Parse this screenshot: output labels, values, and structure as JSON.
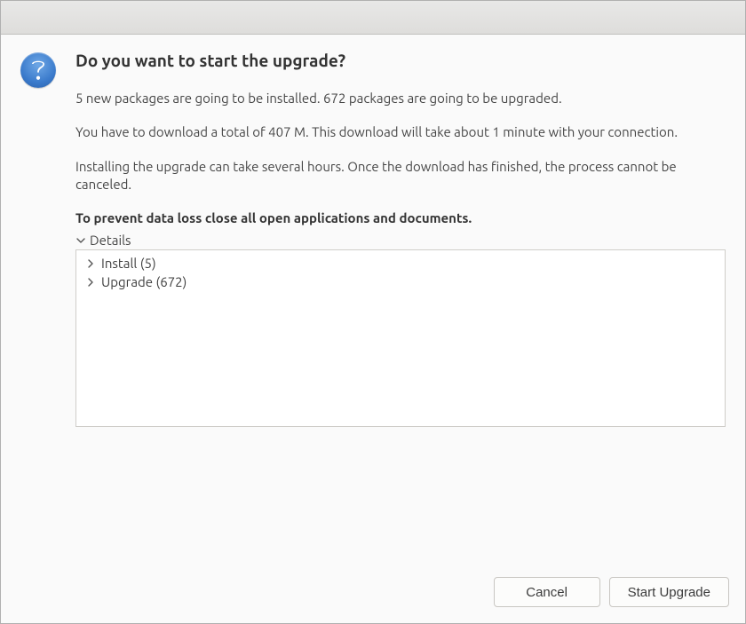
{
  "heading": "Do you want to start the upgrade?",
  "paragraphs": {
    "pkg_summary": "5 new packages are going to be installed. 672 packages are going to be upgraded.",
    "download_info": "You have to download a total of 407 M. This download will take about 1 minute with your connection.",
    "install_warning": "Installing the upgrade can take several hours. Once the download has finished, the process cannot be canceled.",
    "data_loss_warning": "To prevent data loss close all open applications and documents."
  },
  "details": {
    "label": "Details",
    "groups": [
      {
        "label": "Install (5)"
      },
      {
        "label": "Upgrade (672)"
      }
    ]
  },
  "buttons": {
    "cancel": "Cancel",
    "start": "Start Upgrade"
  }
}
